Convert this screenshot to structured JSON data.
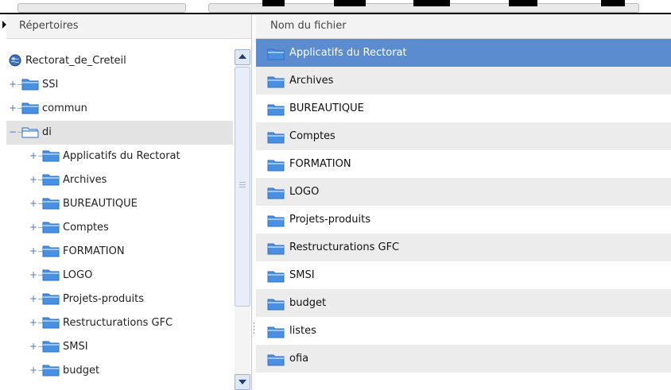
{
  "tree": {
    "header": "Répertoires",
    "items": [
      {
        "label": "Rectorat_de_Creteil",
        "level": 0,
        "expander": "",
        "icon": "globe"
      },
      {
        "label": "SSI",
        "level": 0,
        "expander": "+",
        "icon": "folder"
      },
      {
        "label": "commun",
        "level": 0,
        "expander": "+",
        "icon": "folder"
      },
      {
        "label": "di",
        "level": 0,
        "expander": "−",
        "icon": "folder-open",
        "selected": true
      },
      {
        "label": "Applicatifs du Rectorat",
        "level": 1,
        "expander": "+",
        "icon": "folder"
      },
      {
        "label": "Archives",
        "level": 1,
        "expander": "+",
        "icon": "folder"
      },
      {
        "label": "BUREAUTIQUE",
        "level": 1,
        "expander": "+",
        "icon": "folder"
      },
      {
        "label": "Comptes",
        "level": 1,
        "expander": "+",
        "icon": "folder"
      },
      {
        "label": "FORMATION",
        "level": 1,
        "expander": "+",
        "icon": "folder"
      },
      {
        "label": "LOGO",
        "level": 1,
        "expander": "+",
        "icon": "folder"
      },
      {
        "label": "Projets-produits",
        "level": 1,
        "expander": "+",
        "icon": "folder"
      },
      {
        "label": "Restructurations GFC",
        "level": 1,
        "expander": "+",
        "icon": "folder"
      },
      {
        "label": "SMSI",
        "level": 1,
        "expander": "+",
        "icon": "folder"
      },
      {
        "label": "budget",
        "level": 1,
        "expander": "+",
        "icon": "folder"
      }
    ]
  },
  "files": {
    "header": "Nom du fichier",
    "items": [
      {
        "label": "Applicatifs du Rectorat",
        "selected": true
      },
      {
        "label": "Archives"
      },
      {
        "label": "BUREAUTIQUE"
      },
      {
        "label": "Comptes"
      },
      {
        "label": "FORMATION"
      },
      {
        "label": "LOGO"
      },
      {
        "label": "Projets-produits"
      },
      {
        "label": "Restructurations GFC"
      },
      {
        "label": "SMSI"
      },
      {
        "label": "budget"
      },
      {
        "label": "listes"
      },
      {
        "label": "ofia"
      }
    ]
  },
  "colors": {
    "selection": "#5b8ccf",
    "folder": "#4a90e2",
    "tree_selection": "#e3e3e3"
  }
}
